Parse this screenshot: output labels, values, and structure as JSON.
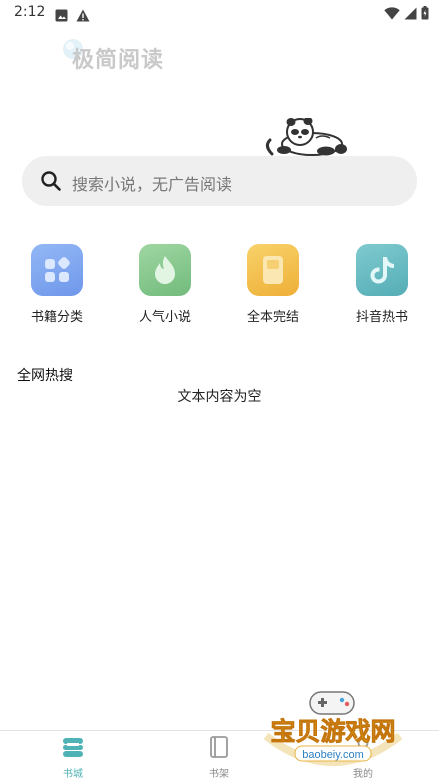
{
  "status_bar": {
    "time": "2:12"
  },
  "app": {
    "logo_text": "极简阅读"
  },
  "search": {
    "placeholder": "搜索小说，无广告阅读"
  },
  "categories": [
    {
      "label": "书籍分类",
      "color": "#7ea8ef"
    },
    {
      "label": "人气小说",
      "color": "#86c98c"
    },
    {
      "label": "全本完结",
      "color": "#f3c04e"
    },
    {
      "label": "抖音热书",
      "color": "#63bcc2"
    }
  ],
  "hot_search": {
    "title": "全网热搜",
    "empty_text": "文本内容为空"
  },
  "bottom_nav": {
    "items": [
      {
        "label": "书城",
        "active": true
      },
      {
        "label": "书架",
        "active": false
      },
      {
        "label": "我的",
        "active": false
      }
    ]
  },
  "watermark": {
    "text": "宝贝游戏网",
    "url": "baobeiy.com"
  },
  "colors": {
    "accent": "#4fb3b5",
    "search_bg": "#efefef"
  }
}
